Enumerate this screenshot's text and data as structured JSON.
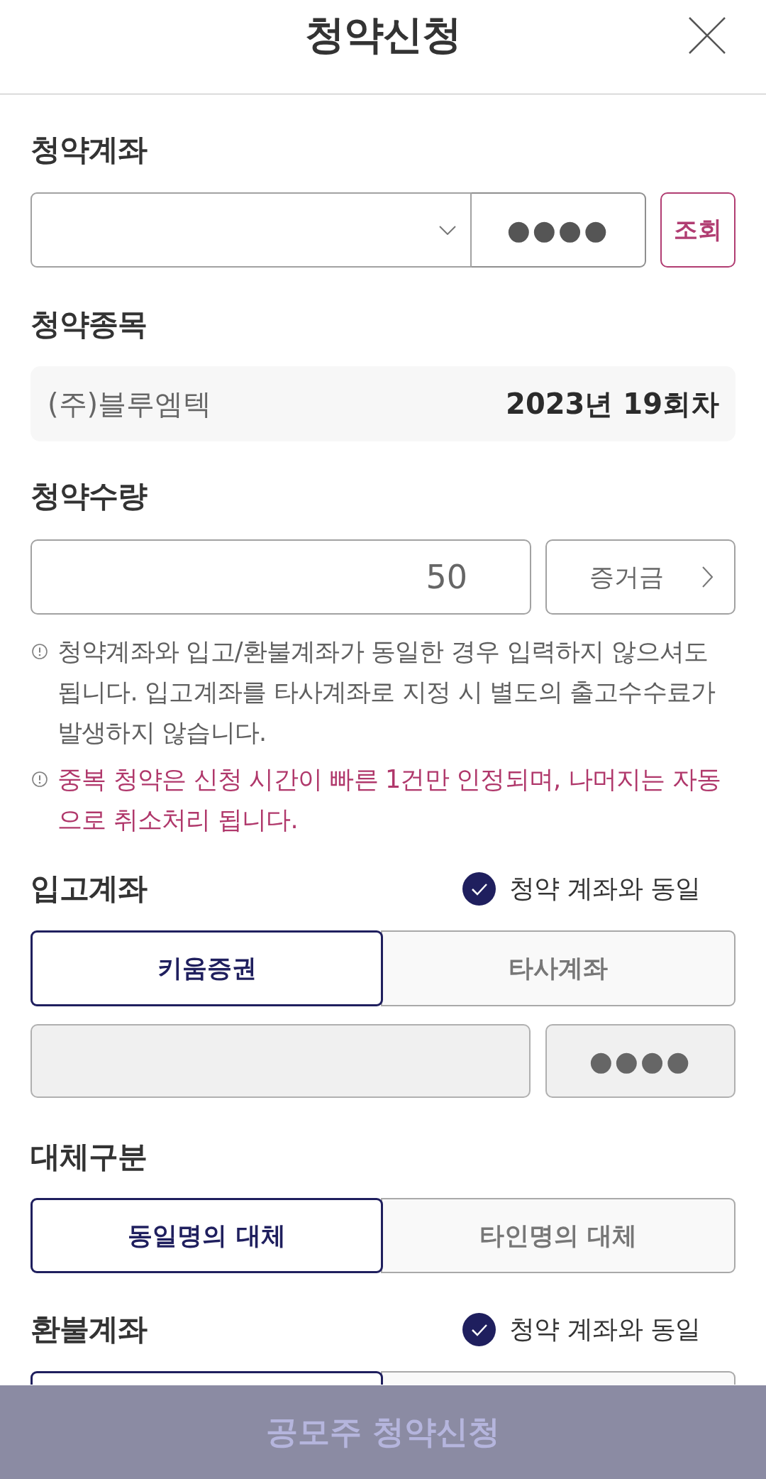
{
  "header": {
    "title": "청약신청"
  },
  "subscription_account": {
    "label": "청약계좌",
    "password_mask": "●●●●",
    "lookup_button": "조회"
  },
  "subscription_stock": {
    "label": "청약종목",
    "name": "(주)블루엠텍",
    "round": "2023년 19회차"
  },
  "subscription_quantity": {
    "label": "청약수량",
    "value": "50",
    "deposit_button": "증거금"
  },
  "notices": [
    {
      "kind": "info",
      "text": "청약계좌와 입고/환불계좌가 동일한 경우 입력하지 않으셔도 됩니다. 입고계좌를 타사계좌로 지정 시 별도의 출고수수료가 발생하지 않습니다."
    },
    {
      "kind": "warning",
      "text": "중복 청약은 신청 시간이 빠른 1건만 인정되며, 나머지는 자동으로 취소처리 됩니다."
    }
  ],
  "deposit_account": {
    "label": "입고계좌",
    "same_as_subscription": {
      "label": "청약 계좌와 동일",
      "checked": true
    },
    "tabs": [
      {
        "label": "키움증권",
        "selected": true
      },
      {
        "label": "타사계좌",
        "selected": false
      }
    ],
    "account_field": {
      "disabled": true
    },
    "password_field": {
      "password_mask": "●●●●",
      "disabled": true
    }
  },
  "transfer_type": {
    "label": "대체구분",
    "tabs": [
      {
        "label": "동일명의 대체",
        "selected": true
      },
      {
        "label": "타인명의 대체",
        "selected": false
      }
    ]
  },
  "refund_account": {
    "label": "환불계좌",
    "same_as_subscription": {
      "label": "청약 계좌와 동일",
      "checked": true
    },
    "tabs": [
      {
        "selected": true
      },
      {
        "selected": false
      }
    ]
  },
  "submit_button": {
    "label": "공모주 청약신청",
    "disabled": true
  }
}
